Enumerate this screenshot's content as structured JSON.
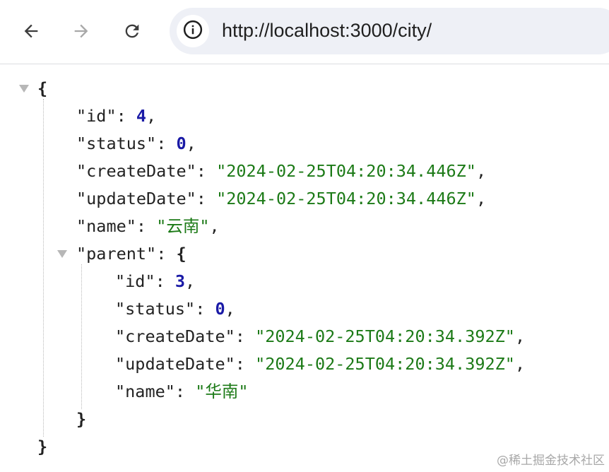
{
  "toolbar": {
    "back_icon": "arrow-left-icon",
    "forward_icon": "arrow-right-icon",
    "reload_icon": "reload-icon",
    "site_info_icon": "info-icon"
  },
  "address_bar": {
    "url": "http://localhost:3000/city/"
  },
  "json_viewer": {
    "root_open": "{",
    "root_close": "}",
    "fields": [
      {
        "key": "\"id\"",
        "value": "4",
        "sep": ": ",
        "trail": ","
      },
      {
        "key": "\"status\"",
        "value": "0",
        "sep": ": ",
        "trail": ","
      },
      {
        "key": "\"createDate\"",
        "value": "\"2024-02-25T04:20:34.446Z\"",
        "sep": ": ",
        "trail": ","
      },
      {
        "key": "\"updateDate\"",
        "value": "\"2024-02-25T04:20:34.446Z\"",
        "sep": ": ",
        "trail": ","
      },
      {
        "key": "\"name\"",
        "value": "\"云南\"",
        "sep": ": ",
        "trail": ","
      }
    ],
    "parent": {
      "key": "\"parent\"",
      "sep": ": ",
      "open": "{",
      "close": "}",
      "fields": [
        {
          "key": "\"id\"",
          "value": "3",
          "sep": ": ",
          "trail": ","
        },
        {
          "key": "\"status\"",
          "value": "0",
          "sep": ": ",
          "trail": ","
        },
        {
          "key": "\"createDate\"",
          "value": "\"2024-02-25T04:20:34.392Z\"",
          "sep": ": ",
          "trail": ","
        },
        {
          "key": "\"updateDate\"",
          "value": "\"2024-02-25T04:20:34.392Z\"",
          "sep": ": ",
          "trail": ","
        },
        {
          "key": "\"name\"",
          "value": "\"华南\"",
          "sep": ": ",
          "trail": ""
        }
      ]
    }
  },
  "watermark": "@稀土掘金技术社区",
  "colors": {
    "key": "#222222",
    "number": "#1a1aa6",
    "string": "#1c7a17",
    "omnibox_bg": "#eef0f6"
  }
}
